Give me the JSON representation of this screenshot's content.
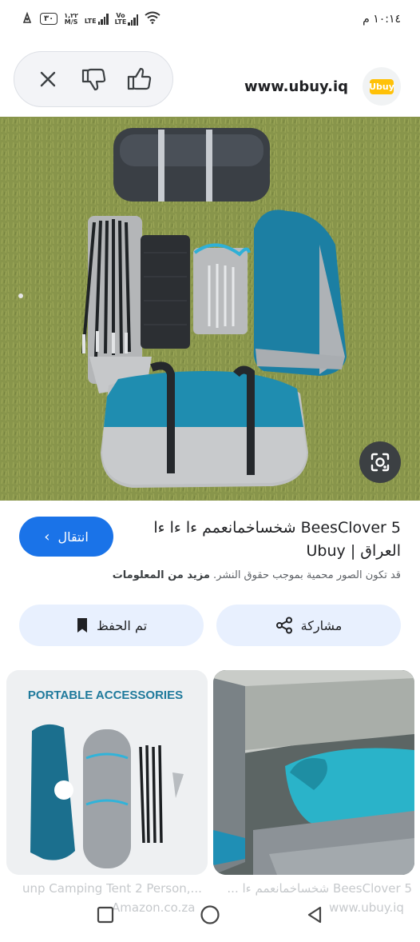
{
  "status_bar": {
    "time": "١٠:١٤ م",
    "battery": "٣٠",
    "speed_value": "١,٢٢",
    "speed_unit": "M/S",
    "network_1": "LTE",
    "network_2_top": "Vo",
    "network_2_bottom": "LTE"
  },
  "header": {
    "site_domain": "www.ubuy.iq",
    "logo_text": "Ubuy"
  },
  "result": {
    "title": "BeesClover 5 شخساخمانعمم ءا ءا ءا العراق | Ubuy",
    "visit_label": "انتقال",
    "notice": "قد تكون الصور محمية بموجب حقوق النشر.",
    "more_info": "مزيد من المعلومات",
    "share_label": "مشاركة",
    "saved_label": "تم الحفظ"
  },
  "related": [
    {
      "banner": "PORTABLE ACCESSORIES",
      "caption": "unp Camping Tent 2 Person,...",
      "source": "Amazon.co.za"
    },
    {
      "caption": "BeesClover 5 شخساخمانعمم ءا ...",
      "source": "www.ubuy.iq"
    }
  ],
  "colors": {
    "accent": "#1a73e8",
    "action_bg": "#e8f0fe",
    "grass": "#8a9648",
    "tent_teal": "#1c7fa3"
  }
}
